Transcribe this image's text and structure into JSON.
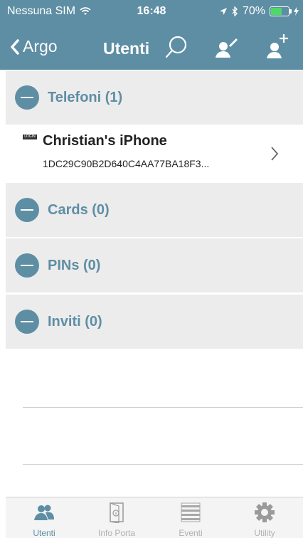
{
  "status_bar": {
    "carrier": "Nessuna SIM",
    "time": "16:48",
    "battery_percent": "70%",
    "battery_level": 0.7,
    "icons": [
      "wifi-icon",
      "location-arrow-icon",
      "bluetooth-icon",
      "battery-icon",
      "charging-icon"
    ]
  },
  "nav": {
    "back_label": "Argo",
    "title": "Utenti",
    "icons": [
      "back-chevron-icon",
      "search-icon",
      "edit-user-icon",
      "add-user-icon"
    ]
  },
  "sections": {
    "telefoni": {
      "label": "Telefoni (1)"
    },
    "cards": {
      "label": "Cards (0)"
    },
    "pins": {
      "label": "PINs (0)"
    },
    "inviti": {
      "label": "Inviti (0)"
    }
  },
  "device": {
    "badge": "LOGIN",
    "name": "Christian's iPhone",
    "id": "1DC29C90B2D640C4AA77BA18F3..."
  },
  "tabs": [
    {
      "label": "Utenti",
      "icon": "users-icon",
      "active": true
    },
    {
      "label": "Info Porta",
      "icon": "door-info-icon",
      "active": false
    },
    {
      "label": "Eventi",
      "icon": "list-icon",
      "active": false
    },
    {
      "label": "Utility",
      "icon": "gear-icon",
      "active": false
    }
  ],
  "colors": {
    "accent": "#5e8ea4",
    "section_background": "#ececec",
    "battery_fill": "#4cd964"
  }
}
